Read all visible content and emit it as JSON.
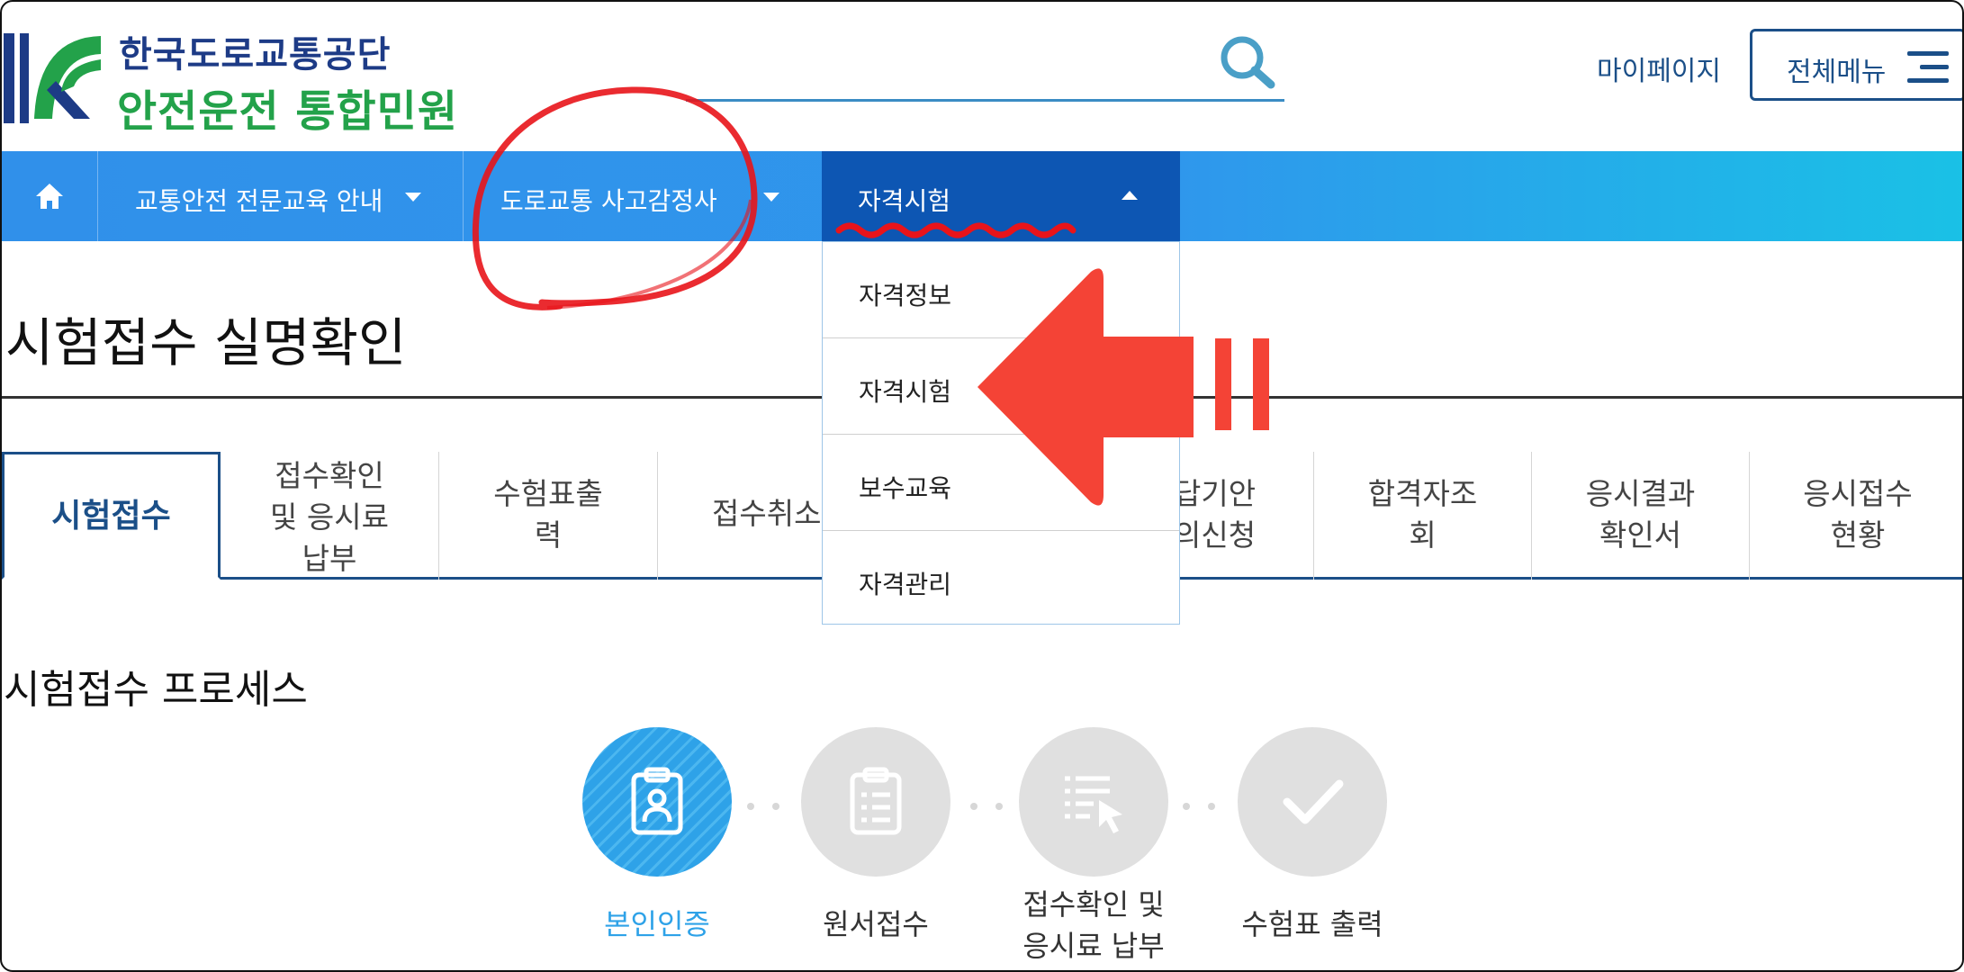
{
  "header": {
    "org_name": "한국도로교통공단",
    "service_name": "안전운전 통합민원",
    "mypage": "마이페이지",
    "all_menu": "전체메뉴"
  },
  "nav": {
    "items": [
      {
        "label": "교통안전 전문교육 안내"
      },
      {
        "label": "도로교통 사고감정사"
      },
      {
        "label": "자격시험"
      }
    ],
    "dropdown": [
      "자격정보",
      "자격시험",
      "보수교육",
      "자격관리"
    ]
  },
  "page": {
    "title": "시험접수 실명확인"
  },
  "tabs": [
    {
      "line1": "시험접수"
    },
    {
      "line1": "접수확인",
      "line2": "및 응시료",
      "line3": "납부"
    },
    {
      "line1": "수험표출",
      "line2": "력"
    },
    {
      "line1": "접수취소"
    },
    {
      "line1": "답기안",
      "line2": "의신청"
    },
    {
      "line1": "합격자조",
      "line2": "회"
    },
    {
      "line1": "응시결과",
      "line2": "확인서"
    },
    {
      "line1": "응시접수",
      "line2": "현황"
    }
  ],
  "process": {
    "title": "시험접수 프로세스",
    "steps": [
      {
        "line1": "본인인증",
        "icon": "clipboard-person-icon"
      },
      {
        "line1": "원서접수",
        "icon": "clipboard-list-icon"
      },
      {
        "line1": "접수확인 및",
        "line2": "응시료 납부",
        "icon": "list-cursor-icon"
      },
      {
        "line1": "수험표 출력",
        "icon": "check-icon"
      }
    ]
  },
  "colors": {
    "nav_gradient_start": "#3090ea",
    "nav_gradient_end": "#1ac1e6",
    "nav_active": "#0d56b3",
    "brand_blue": "#1b4f88",
    "brand_green": "#23a24a",
    "step_active": "#2ea2e8",
    "annotation_red": "#f44336"
  }
}
